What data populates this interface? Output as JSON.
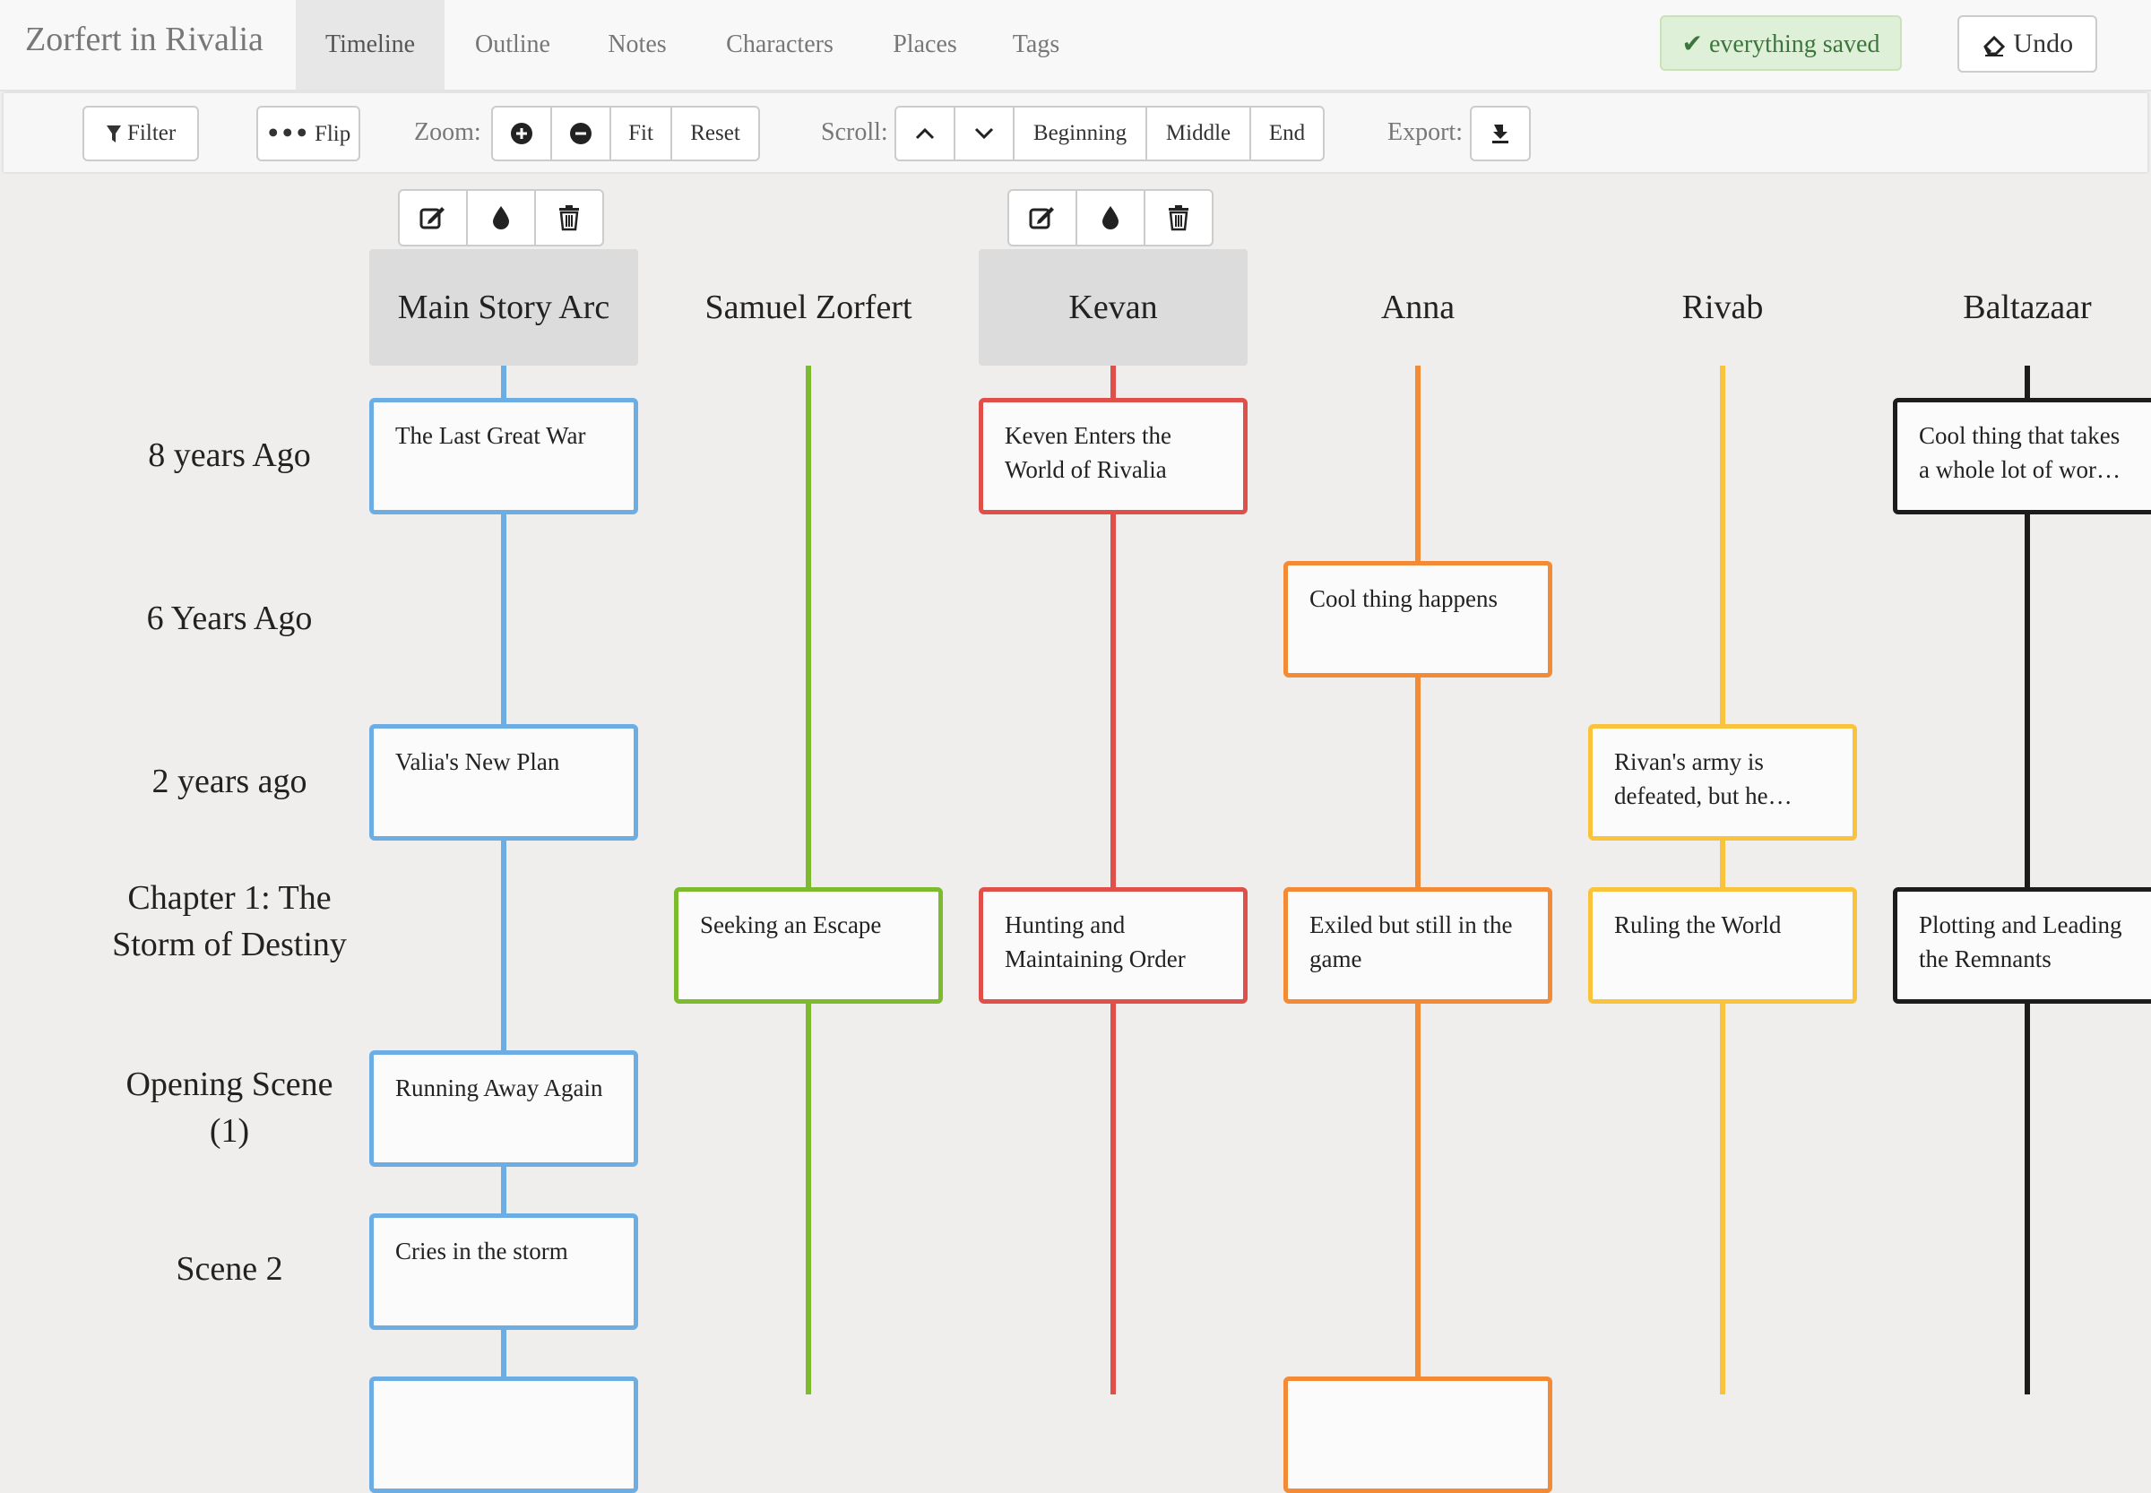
{
  "app": {
    "title": "Zorfert in Rivalia",
    "nav_tabs": [
      {
        "label": "Timeline",
        "active": true
      },
      {
        "label": "Outline"
      },
      {
        "label": "Notes"
      },
      {
        "label": "Characters"
      },
      {
        "label": "Places"
      },
      {
        "label": "Tags"
      }
    ],
    "save_status": "everything saved",
    "undo_label": "Undo"
  },
  "toolbar": {
    "filter_label": "Filter",
    "flip_label": "Flip",
    "zoom_label": "Zoom:",
    "zoom_fit": "Fit",
    "zoom_reset": "Reset",
    "scroll_label": "Scroll:",
    "scroll_beginning": "Beginning",
    "scroll_middle": "Middle",
    "scroll_end": "End",
    "export_label": "Export:"
  },
  "colors": {
    "blue": "#6caee4",
    "green": "#7cbb2e",
    "red": "#e0504a",
    "orange": "#f28a36",
    "yellow": "#f9c33c",
    "black": "#1c1c1c"
  },
  "timeline": {
    "columns": [
      {
        "name": "Main Story Arc",
        "color": "blue",
        "selected": true
      },
      {
        "name": "Samuel Zorfert",
        "color": "green"
      },
      {
        "name": "Kevan",
        "color": "red",
        "selected": true
      },
      {
        "name": "Anna",
        "color": "orange"
      },
      {
        "name": "Rivab",
        "color": "yellow"
      },
      {
        "name": "Baltazaar",
        "color": "black"
      }
    ],
    "rows": [
      {
        "label": "8 years Ago"
      },
      {
        "label": "6 Years Ago"
      },
      {
        "label": "2 years ago"
      },
      {
        "label": "Chapter 1: The Storm of Destiny"
      },
      {
        "label": "Opening Scene (1)"
      },
      {
        "label": "Scene 2"
      }
    ],
    "cards": {
      "main_8y": "The Last Great War",
      "main_2y": "Valia's New Plan",
      "main_opening": "Running Away Again",
      "main_scene2": "Cries in the storm",
      "samuel_ch1": "Seeking an Escape",
      "kevan_8y": "Keven Enters the World of Rivalia",
      "kevan_ch1": "Hunting and Maintaining Order",
      "anna_6y": "Cool thing happens",
      "anna_ch1": "Exiled but still in the game",
      "rivab_2y": "Rivan's army is defeated, but he…",
      "rivab_ch1": "Ruling the World",
      "baltazaar_8y": "Cool thing that takes a whole lot of wor…",
      "baltazaar_ch1": "Plotting and Leading the Remnants"
    }
  }
}
